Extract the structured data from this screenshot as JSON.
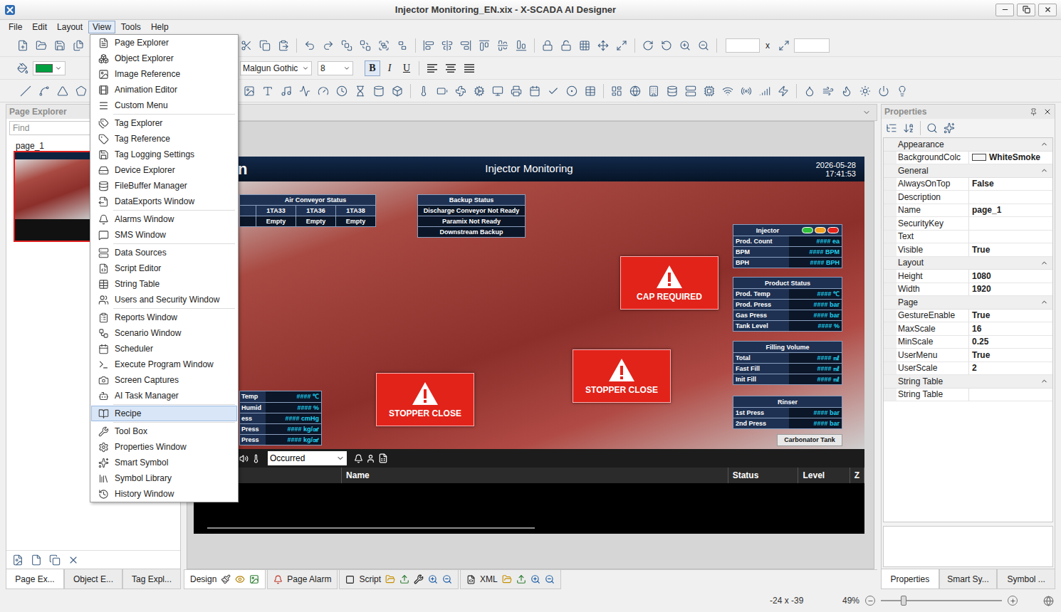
{
  "window": {
    "title": "Injector Monitoring_EN.xix - X-SCADA AI Designer"
  },
  "menu_bar": [
    {
      "label": "File",
      "selected": false
    },
    {
      "label": "Edit",
      "selected": false
    },
    {
      "label": "Layout",
      "selected": false
    },
    {
      "label": "View",
      "selected": true
    },
    {
      "label": "Tools",
      "selected": false
    },
    {
      "label": "Help",
      "selected": false
    }
  ],
  "view_menu": {
    "groups": [
      [
        {
          "label": "Page Explorer",
          "selected": false
        },
        {
          "label": "Object Explorer",
          "selected": false
        },
        {
          "label": "Image Reference",
          "selected": false
        },
        {
          "label": "Animation Editor",
          "selected": false
        },
        {
          "label": "Custom Menu",
          "selected": false
        }
      ],
      [
        {
          "label": "Tag Explorer",
          "selected": false
        },
        {
          "label": "Tag Reference",
          "selected": false
        },
        {
          "label": "Tag Logging Settings",
          "selected": false
        },
        {
          "label": "Device Explorer",
          "selected": false
        },
        {
          "label": "FileBuffer Manager",
          "selected": false
        },
        {
          "label": "DataExports Window",
          "selected": false
        }
      ],
      [
        {
          "label": "Alarms Window",
          "selected": false
        },
        {
          "label": "SMS Window",
          "selected": false
        }
      ],
      [
        {
          "label": "Data Sources",
          "selected": false
        },
        {
          "label": "Script Editor",
          "selected": false
        },
        {
          "label": "String Table",
          "selected": false
        },
        {
          "label": "Users and Security Window",
          "selected": false
        }
      ],
      [
        {
          "label": "Reports Window",
          "selected": false
        },
        {
          "label": "Scenario Window",
          "selected": false
        },
        {
          "label": "Scheduler",
          "selected": false
        },
        {
          "label": "Execute Program Window",
          "selected": false
        },
        {
          "label": "Screen Captures",
          "selected": false
        },
        {
          "label": "AI Task Manager",
          "selected": false
        }
      ],
      [
        {
          "label": "Recipe",
          "selected": true
        }
      ],
      [
        {
          "label": "Tool Box",
          "selected": false
        },
        {
          "label": "Properties Window",
          "selected": false
        },
        {
          "label": "Smart Symbol",
          "selected": false
        },
        {
          "label": "Symbol Library",
          "selected": false
        },
        {
          "label": "History Window",
          "selected": false
        }
      ]
    ]
  },
  "toolbar": {
    "size_separator": "x",
    "width": "",
    "height": "",
    "fill_color": "#00a040",
    "font": "Malgun Gothic",
    "font_size": "8",
    "styles": [
      {
        "label": "B",
        "selected": true
      },
      {
        "label": "I",
        "selected": false
      },
      {
        "label": "U",
        "selected": false
      }
    ]
  },
  "page_explorer": {
    "title": "Page Explorer",
    "search_placeholder": "Find",
    "pages": [
      {
        "label": "page_1",
        "selected": true
      }
    ],
    "tabs": [
      {
        "label": "Page Ex...",
        "selected": true
      },
      {
        "label": "Object E...",
        "selected": false
      },
      {
        "label": "Tag Expl...",
        "selected": false
      }
    ]
  },
  "scada_page": {
    "header": {
      "logo": "n",
      "title": "Injector Monitoring",
      "date": "2026-05-28",
      "time": "17:41:53"
    },
    "air_conveyor": {
      "title": "Air Conveyor Status",
      "columns": [
        "1TA33",
        "1TA36",
        "1TA38"
      ],
      "values": [
        "Empty",
        "Empty",
        "Empty"
      ]
    },
    "backup_status": {
      "title": "Backup Status",
      "rows": [
        "Discharge Conveyor Not Ready",
        "Paramix Not Ready",
        "Downstream Backup"
      ]
    },
    "panels": [
      {
        "title": "Injector",
        "lights": [
          {
            "color": "#2fbf3a"
          },
          {
            "color": "#f0a020"
          },
          {
            "color": "#e5231b"
          }
        ],
        "rows": [
          {
            "label": "Prod. Count",
            "value": "####",
            "unit": "ea"
          },
          {
            "label": "BPM",
            "value": "####",
            "unit": "BPM"
          },
          {
            "label": "BPH",
            "value": "####",
            "unit": "BPH"
          }
        ]
      },
      {
        "title": "Product Status",
        "lights": [],
        "rows": [
          {
            "label": "Prod. Temp",
            "value": "####",
            "unit": "℃"
          },
          {
            "label": "Prod. Press",
            "value": "####",
            "unit": "bar"
          },
          {
            "label": "Gas Press",
            "value": "####",
            "unit": "bar"
          },
          {
            "label": "Tank Level",
            "value": "####",
            "unit": "%"
          }
        ]
      },
      {
        "title": "Filling Volume",
        "lights": [],
        "rows": [
          {
            "label": "Total",
            "value": "####",
            "unit": "㎖"
          },
          {
            "label": "Fast Fill",
            "value": "####",
            "unit": "㎖"
          },
          {
            "label": "Init Fill",
            "value": "####",
            "unit": "㎖"
          }
        ]
      },
      {
        "title": "Rinser",
        "lights": [],
        "rows": [
          {
            "label": "1st Press",
            "value": "####",
            "unit": "bar"
          },
          {
            "label": "2nd Press",
            "value": "####",
            "unit": "bar"
          }
        ]
      }
    ],
    "sensors": [
      {
        "label": "Temp",
        "value": "####",
        "unit": "℃"
      },
      {
        "label": "Humid",
        "value": "####",
        "unit": "%"
      },
      {
        "label": "ess",
        "value": "####",
        "unit": "cmHg"
      },
      {
        "label": "Press",
        "value": "####",
        "unit": "kg/㎠"
      },
      {
        "label": "Press",
        "value": "####",
        "unit": "kg/㎠"
      }
    ],
    "alarm_badges": [
      {
        "label": "CAP REQUIRED"
      },
      {
        "label": "STOPPER CLOSE"
      },
      {
        "label": "STOPPER CLOSE"
      }
    ],
    "tank_label": "Carbonator Tank",
    "alarm_list": {
      "filter": "Occurred",
      "columns": [
        "Name",
        "Status",
        "Level",
        "Z"
      ]
    }
  },
  "design_tabs": [
    {
      "label": "Design",
      "selected": true
    },
    {
      "label": "Page Alarm",
      "selected": false
    },
    {
      "label": "Script",
      "selected": false
    },
    {
      "label": "XML",
      "selected": false
    }
  ],
  "properties": {
    "title": "Properties",
    "categories": [
      {
        "name": "Appearance",
        "expanded": true,
        "rows": [
          {
            "name": "BackgroundColc",
            "value": "WhiteSmoke",
            "swatch": "#f5f5f5"
          }
        ]
      },
      {
        "name": "General",
        "expanded": true,
        "rows": [
          {
            "name": "AlwaysOnTop",
            "value": "False"
          },
          {
            "name": "Description",
            "value": ""
          },
          {
            "name": "Name",
            "value": "page_1"
          },
          {
            "name": "SecurityKey",
            "value": ""
          },
          {
            "name": "Text",
            "value": ""
          },
          {
            "name": "Visible",
            "value": "True"
          }
        ]
      },
      {
        "name": "Layout",
        "expanded": true,
        "rows": [
          {
            "name": "Height",
            "value": "1080"
          },
          {
            "name": "Width",
            "value": "1920"
          }
        ]
      },
      {
        "name": "Page",
        "expanded": true,
        "rows": [
          {
            "name": "GestureEnable",
            "value": "True"
          },
          {
            "name": "MaxScale",
            "value": "16"
          },
          {
            "name": "MinScale",
            "value": "0.25"
          },
          {
            "name": "UserMenu",
            "value": "True"
          },
          {
            "name": "UserScale",
            "value": "2"
          }
        ]
      },
      {
        "name": "String Table",
        "expanded": true,
        "rows": [
          {
            "name": "String Table",
            "value": ""
          }
        ]
      }
    ],
    "tabs": [
      {
        "label": "Properties",
        "selected": true
      },
      {
        "label": "Smart Sy...",
        "selected": false
      },
      {
        "label": "Symbol ...",
        "selected": false
      }
    ]
  },
  "status_bar": {
    "coords": "-24 x -39",
    "zoom": "49%",
    "zoom_level": 0.19
  }
}
